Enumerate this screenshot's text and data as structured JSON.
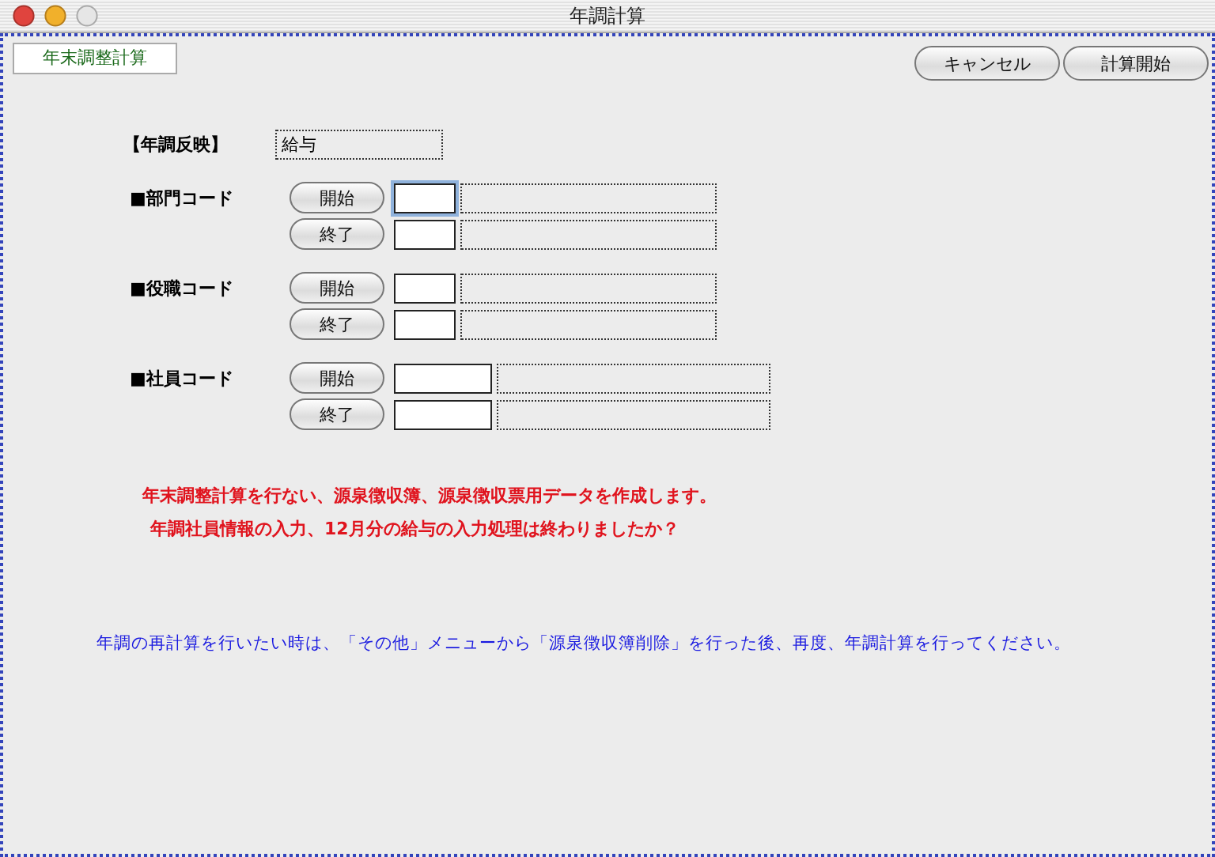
{
  "window": {
    "title": "年調計算"
  },
  "tab": {
    "label": "年末調整計算"
  },
  "buttons": [
    "キャンセル",
    "計算開始"
  ],
  "reflect": {
    "label": "【年調反映】",
    "value": "給与"
  },
  "code_groups": [
    {
      "label": "■部門コード",
      "kind": "short",
      "rows": [
        {
          "button": "開始",
          "focused": true
        },
        {
          "button": "終了",
          "focused": false
        }
      ]
    },
    {
      "label": "■役職コード",
      "kind": "short",
      "rows": [
        {
          "button": "開始",
          "focused": false
        },
        {
          "button": "終了",
          "focused": false
        }
      ]
    },
    {
      "label": "■社員コード",
      "kind": "long",
      "rows": [
        {
          "button": "開始",
          "focused": false
        },
        {
          "button": "終了",
          "focused": false
        }
      ]
    }
  ],
  "notice": [
    "年末調整計算を行ない、源泉徴収簿、源泉徴収票用データを作成します。",
    "年調社員情報の入力、12月分の給与の入力処理は終わりましたか？"
  ],
  "hint": "年調の再計算を行いたい時は、「その他」メニューから「源泉徴収簿削除」を行った後、再度、年調計算を行ってください。"
}
